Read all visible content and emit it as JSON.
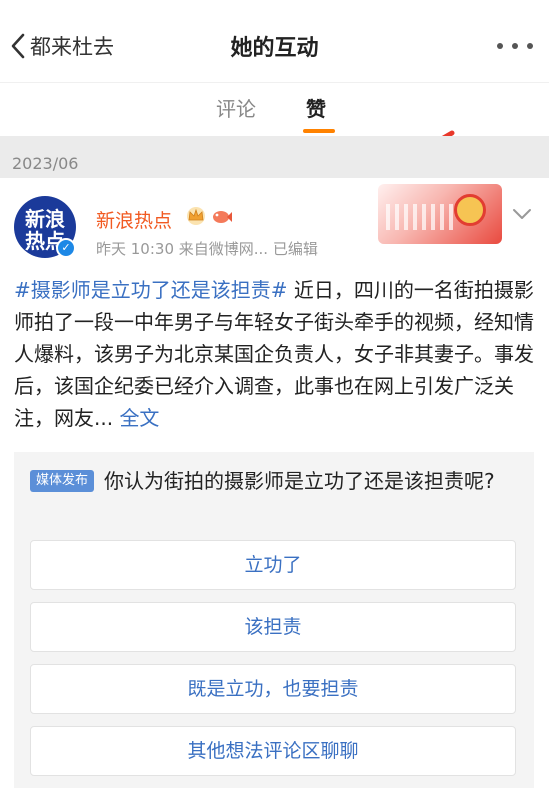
{
  "nav": {
    "back_label": "都来杜去",
    "title": "她的互动"
  },
  "tabs": [
    {
      "label": "评论",
      "active": false
    },
    {
      "label": "赞",
      "active": true
    }
  ],
  "colors": {
    "accent": "#ff8200",
    "link": "#3a70c2",
    "author": "#f15a22",
    "arrow": "#e8382a"
  },
  "date_group": "2023/06",
  "post": {
    "avatar_text": "新浪热点",
    "author": "新浪热点",
    "author_icons": [
      "crown-icon",
      "fish-icon"
    ],
    "meta": "昨天 10:30  来自微博网...  已编辑",
    "hashtag": "#摄影师是立功了还是该担责#",
    "body": " 近日，四川的一名街拍摄影师拍了一段一中年男子与年轻女子街头牵手的视频，经知情人爆料，该男子为北京某国企负责人，女子非其妻子。事发后，该国企纪委已经介入调查，此事也在网上引发广泛关注，网友...",
    "full_text": "全文"
  },
  "poll": {
    "badge": "媒体发布",
    "question": "你认为街拍的摄影师是立功了还是该担责呢?",
    "options": [
      "立功了",
      "该担责",
      "既是立功，也要担责",
      "其他想法评论区聊聊"
    ]
  }
}
